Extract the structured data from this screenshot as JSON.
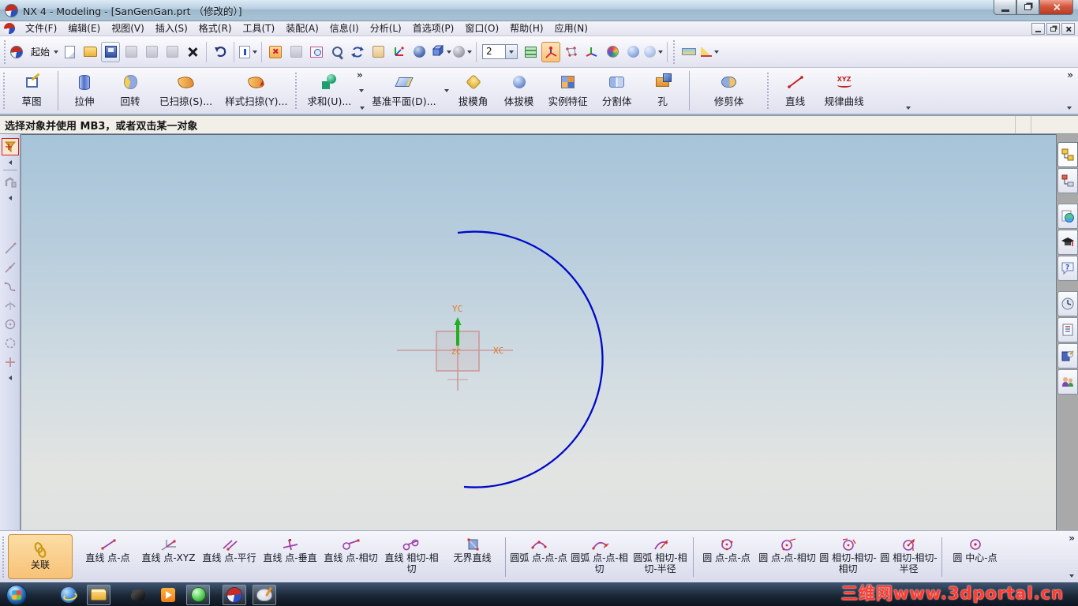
{
  "window": {
    "title": "NX 4 - Modeling - [SanGenGan.prt （修改的）]"
  },
  "glyphs": {
    "overflow": "»"
  },
  "menu": {
    "items": [
      "文件(F)",
      "编辑(E)",
      "视图(V)",
      "插入(S)",
      "格式(R)",
      "工具(T)",
      "装配(A)",
      "信息(I)",
      "分析(L)",
      "首选项(P)",
      "窗口(O)",
      "帮助(H)",
      "应用(N)"
    ]
  },
  "toolbar_main": {
    "start_label": "起始",
    "layer_value": "2"
  },
  "feature_toolbar": {
    "buttons": [
      "草图",
      "拉伸",
      "回转",
      "已扫掠(S)...",
      "样式扫掠(Y)...",
      "求和(U)...",
      "基准平面(D)...",
      "拔模角",
      "体拔模",
      "实例特征",
      "分割体",
      "孔",
      "修剪体",
      "直线",
      "规律曲线"
    ]
  },
  "icons": {
    "law_curve_text": "XYZ"
  },
  "prompt_bar": {
    "text": "选择对象并使用 MB3，或者双击某一对象"
  },
  "viewport": {
    "axis_labels": {
      "x": "XC",
      "y": "YC",
      "z": "ZC"
    }
  },
  "curve_toolbar": {
    "buttons": [
      "关联",
      "直线 点-点",
      "直线 点-XYZ",
      "直线 点-平行",
      "直线 点-垂直",
      "直线 点-相切",
      "直线 相切-相切",
      "无界直线",
      "圆弧 点-点-点",
      "圆弧 点-点-相切",
      "圆弧 相切-相切-半径",
      "圆 点-点-点",
      "圆 点-点-相切",
      "圆 相切-相切-相切",
      "圆 相切-相切-半径",
      "圆 中心-点"
    ]
  },
  "watermark": {
    "text": "三维网www.3dportal.cn"
  },
  "colors": {
    "arc": "#0008c8",
    "wcs": "#cc9999",
    "axis_y": "#22b020",
    "axis_label": "#e07820",
    "highlight": "#f8c27c",
    "watermark": "#ff3b30"
  }
}
